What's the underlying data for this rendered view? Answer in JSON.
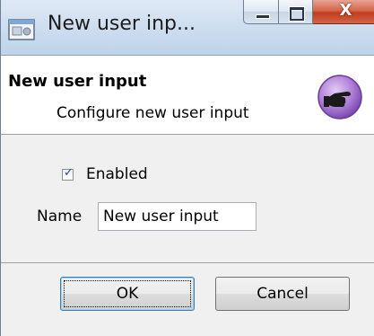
{
  "window": {
    "title": "New user inp...",
    "close_glyph": "X",
    "icon": "dialog-window-icon"
  },
  "header": {
    "title": "New user input",
    "subtitle": "Configure new user input",
    "icon": "pointing-hand-icon",
    "icon_color": "#b07fd8"
  },
  "form": {
    "enabled": {
      "label": "Enabled",
      "checked": true
    },
    "name": {
      "label": "Name",
      "value": "New user input"
    }
  },
  "buttons": {
    "ok_label": "OK",
    "cancel_label": "Cancel"
  },
  "colors": {
    "accent_close": "#c23c1c",
    "focus_border": "#3c7fb1"
  }
}
